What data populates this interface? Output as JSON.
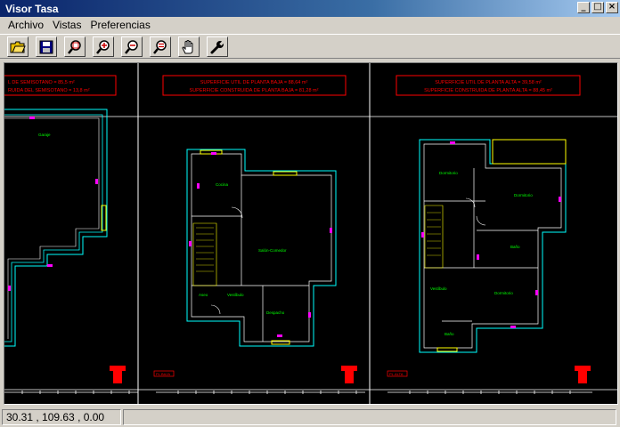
{
  "window": {
    "title": "Visor Tasa"
  },
  "menu": {
    "items": [
      "Archivo",
      "Vistas",
      "Preferencias"
    ]
  },
  "toolbar": {
    "buttons": [
      "open-folder-icon",
      "save-icon",
      "zoom-window-icon",
      "zoom-in-icon",
      "zoom-out-icon",
      "zoom-extents-icon",
      "pan-hand-icon",
      "settings-wrench-icon"
    ]
  },
  "drawing": {
    "sheet1": {
      "line1": "L DE SEMISOTANO = 85,5 m²",
      "line2": "RUIDA DEL SEMISOTANO = 13,8 m²",
      "room": "Garaje"
    },
    "sheet2": {
      "line1": "SUPERFICIE UTIL DE PLANTA BAJA = 88,64 m²",
      "line2": "SUPERFICIE CONSTRUIDA DE PLANTA BAJA = 81,28 m²",
      "rooms": [
        "Cocina",
        "Salón-Comedor",
        "Aseo",
        "Vestíbulo",
        "Despacho"
      ],
      "tag": "PL.BAJA"
    },
    "sheet3": {
      "line1": "SUPERFICIE UTIL DE PLANTA ALTA = 39,58 m²",
      "line2": "SUPERFICIE CONSTRUIDA DE PLANTA ALTA = 88,45 m²",
      "rooms": [
        "Dormitorio",
        "Dormitorio",
        "Baño",
        "Vestíbulo",
        "Dormitorio",
        "Baño"
      ],
      "tag": "PL.ALTA"
    }
  },
  "status": {
    "coordinates": "30.31 , 109.63 , 0.00",
    "info": ""
  }
}
